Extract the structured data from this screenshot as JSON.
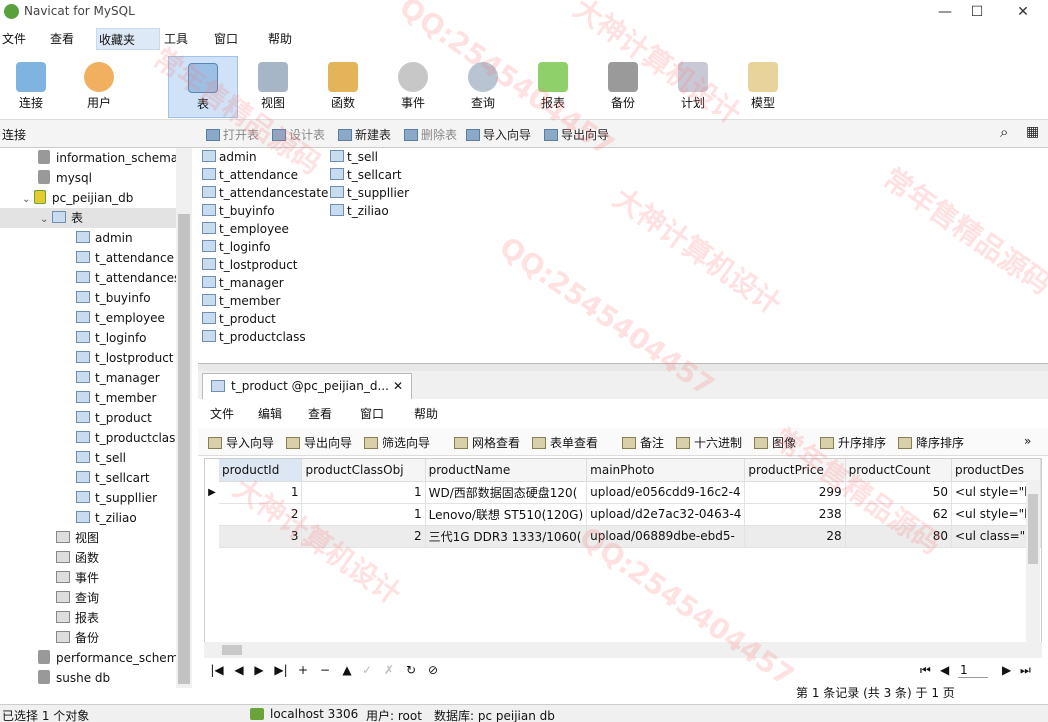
{
  "window": {
    "title": "Navicat for MySQL",
    "min": "—",
    "max": "☐",
    "close": "✕"
  },
  "menu": [
    "文件",
    "查看",
    "收藏夹",
    "工具",
    "窗口",
    "帮助"
  ],
  "toolbar": [
    {
      "label": "连接",
      "icon": "plug-icon"
    },
    {
      "label": "用户",
      "icon": "user-icon"
    },
    {
      "label": "表",
      "icon": "table-icon"
    },
    {
      "label": "视图",
      "icon": "view-icon"
    },
    {
      "label": "函数",
      "icon": "function-icon"
    },
    {
      "label": "事件",
      "icon": "clock-icon"
    },
    {
      "label": "查询",
      "icon": "query-icon"
    },
    {
      "label": "报表",
      "icon": "report-icon"
    },
    {
      "label": "备份",
      "icon": "backup-icon"
    },
    {
      "label": "计划",
      "icon": "schedule-icon"
    },
    {
      "label": "模型",
      "icon": "model-icon"
    }
  ],
  "subbar": {
    "connection_label": "连接",
    "actions": [
      {
        "label": "打开表",
        "enabled": false
      },
      {
        "label": "设计表",
        "enabled": false
      },
      {
        "label": "新建表",
        "enabled": true
      },
      {
        "label": "删除表",
        "enabled": false
      },
      {
        "label": "导入向导",
        "enabled": true
      },
      {
        "label": "导出向导",
        "enabled": true
      }
    ]
  },
  "tree": {
    "databases_top": [
      "information_schema",
      "mysql",
      "pc_peijian_db"
    ],
    "tables_label": "表",
    "tables": [
      "admin",
      "t_attendance",
      "t_attendances",
      "t_buyinfo",
      "t_employee",
      "t_loginfo",
      "t_lostproduct",
      "t_manager",
      "t_member",
      "t_product",
      "t_productclass",
      "t_sell",
      "t_sellcart",
      "t_suppllier",
      "t_ziliao"
    ],
    "others": [
      "视图",
      "函数",
      "事件",
      "查询",
      "报表",
      "备份"
    ],
    "databases_bottom": [
      "performance_schem",
      "sushe db"
    ]
  },
  "objects": {
    "col1": [
      "admin",
      "t_attendance",
      "t_attendancestate",
      "t_buyinfo",
      "t_employee",
      "t_loginfo",
      "t_lostproduct",
      "t_manager",
      "t_member",
      "t_product",
      "t_productclass"
    ],
    "col2": [
      "t_sell",
      "t_sellcart",
      "t_suppllier",
      "t_ziliao"
    ]
  },
  "tab": {
    "title": "t_product @pc_peijian_d...",
    "close": "✕"
  },
  "inner_menu": [
    "文件",
    "编辑",
    "查看",
    "窗口",
    "帮助"
  ],
  "inner_toolbar": [
    "导入向导",
    "导出向导",
    "筛选向导",
    "网格查看",
    "表单查看",
    "备注",
    "十六进制",
    "图像",
    "升序排序",
    "降序排序"
  ],
  "grid": {
    "columns": [
      "productId",
      "productClassObj",
      "productName",
      "mainPhoto",
      "productPrice",
      "productCount",
      "productDes"
    ],
    "rows": [
      [
        "1",
        "1",
        "WD/西部数据固态硬盘120(",
        "upload/e056cdd9-16c2-4",
        "299",
        "50",
        "<ul style=\"li"
      ],
      [
        "2",
        "1",
        "Lenovo/联想 ST510(120G)",
        "upload/d2e7ac32-0463-4",
        "238",
        "62",
        "<ul style=\"li"
      ],
      [
        "3",
        "2",
        "三代1G DDR3 1333/1060(",
        "upload/06889dbe-ebd5-",
        "28",
        "80",
        "<ul class=\"a"
      ]
    ]
  },
  "nav": {
    "buttons": [
      "|◀",
      "◀",
      "▶",
      "▶|",
      "+",
      "−",
      "▲",
      "✓",
      "✗",
      "↻",
      "⊘"
    ],
    "page": "1",
    "records": "第 1 条记录 (共 3 条) 于 1 页"
  },
  "status": {
    "selection": "已选择 1 个对象",
    "host": "localhost 3306",
    "user": "用户: root",
    "db": "数据库: pc peijian db"
  },
  "watermarks": [
    "大神计算机设计",
    "QQ:2545404457",
    "常年售精品源码",
    "大神计算机设计",
    "QQ:2545404457",
    "常年售精品源码",
    "大神计算机设计",
    "QQ:2545404457",
    "常年售精品源码"
  ]
}
